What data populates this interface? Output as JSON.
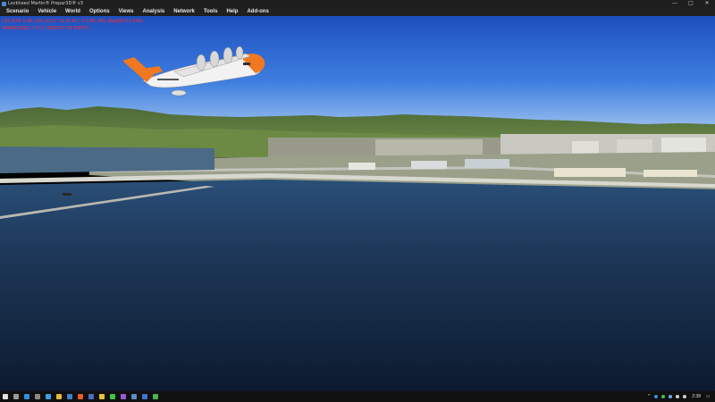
{
  "window": {
    "title": "Lockheed Martin® Prepar3D® v3",
    "minimize_glyph": "—",
    "maximize_glyph": "□",
    "close_glyph": "✕"
  },
  "menu": {
    "items": [
      "Scenario",
      "Vehicle",
      "World",
      "Options",
      "Views",
      "Analysis",
      "Network",
      "Tools",
      "Help",
      "Add-ons"
    ]
  },
  "hud": {
    "line1": "LAT: N34° 8.48'  LON: E132° 16.15'  ALT: 172 ML  MSL  Mag268  0.0 KIAS",
    "line2": "FRAMES/SEC = 27.1  (TARGET OF 60FPS)"
  },
  "taskbar": {
    "start_icon": "windows-start-icon",
    "pinned": [
      {
        "name": "search-icon",
        "color": "#9a9a9a"
      },
      {
        "name": "edge-icon",
        "color": "#2f8ee0"
      },
      {
        "name": "task-view-icon",
        "color": "#8a8a8a"
      },
      {
        "name": "store-icon",
        "color": "#3aa0e8"
      },
      {
        "name": "file-explorer-icon",
        "color": "#e8b93a"
      },
      {
        "name": "mail-icon",
        "color": "#3d7fd6"
      },
      {
        "name": "media-player-icon",
        "color": "#e85a2a"
      },
      {
        "name": "photos-icon",
        "color": "#4b6cc9"
      },
      {
        "name": "chrome-icon",
        "color": "#e8c23a"
      },
      {
        "name": "line-icon",
        "color": "#3ec24a"
      },
      {
        "name": "app-purple-icon",
        "color": "#9a5ad6"
      },
      {
        "name": "prepar3d-icon",
        "color": "#5a8ec8"
      },
      {
        "name": "app-blue-icon",
        "color": "#3a78d0"
      },
      {
        "name": "app-green-icon",
        "color": "#4ab050"
      }
    ],
    "tray": [
      {
        "name": "chevron-up-icon",
        "color": "#cfcfcf"
      },
      {
        "name": "tray-app-icon",
        "color": "#3a8ee0"
      },
      {
        "name": "tray-green-icon",
        "color": "#3ec24a"
      },
      {
        "name": "tray-cloud-icon",
        "color": "#6ab0e8"
      },
      {
        "name": "network-icon",
        "color": "#cfcfcf"
      },
      {
        "name": "volume-icon",
        "color": "#cfcfcf"
      }
    ],
    "clock": "2:38",
    "notification_icon": "notification-icon"
  }
}
